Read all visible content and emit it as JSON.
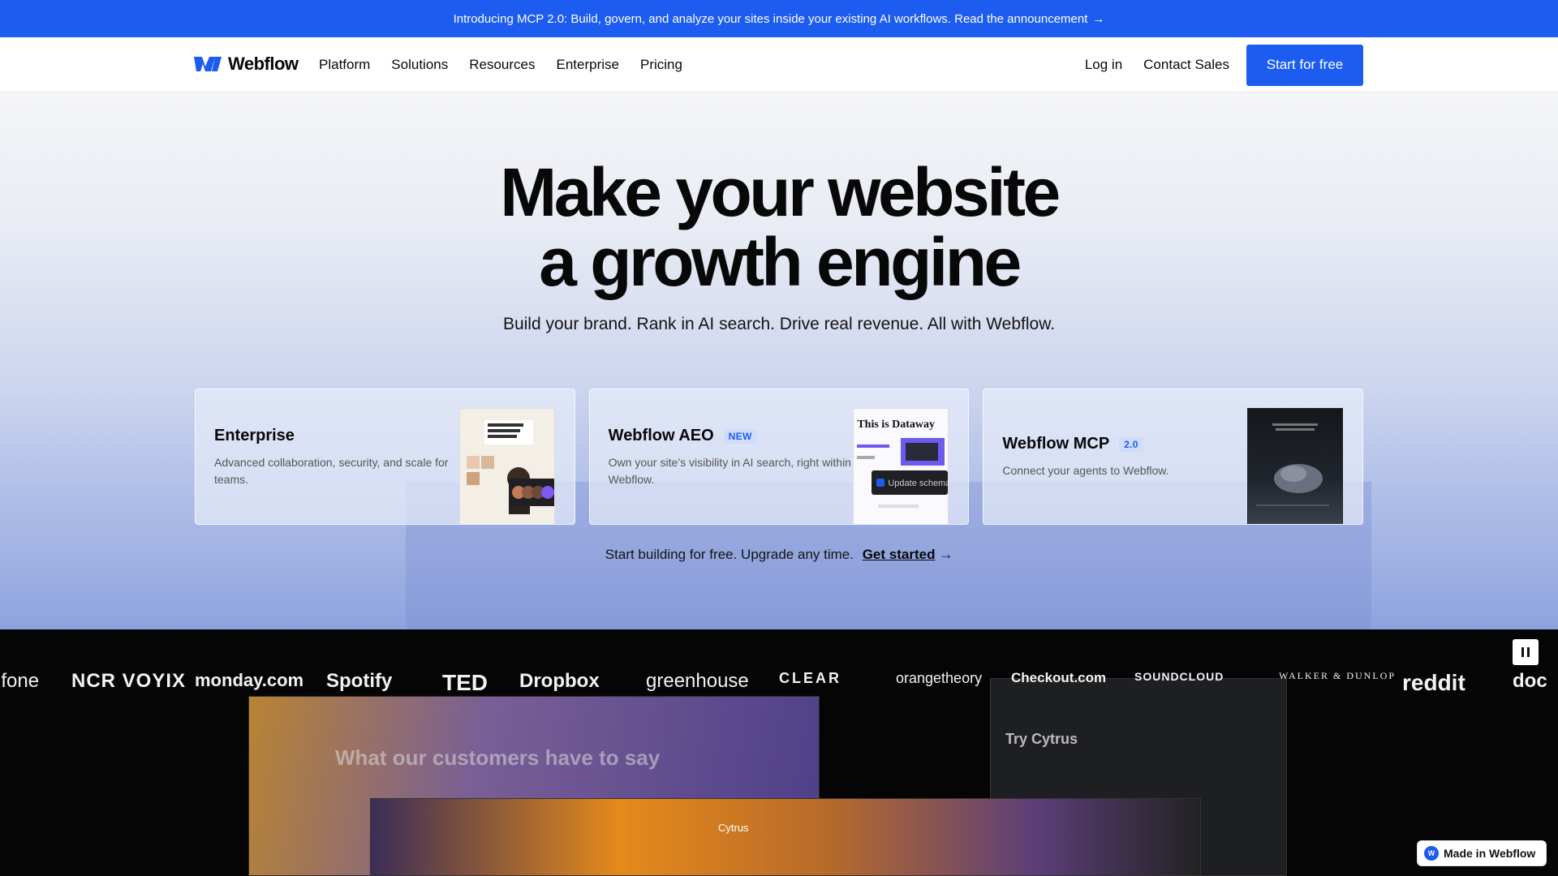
{
  "banner": {
    "text": "Introducing MCP 2.0: Build, govern, and analyze your sites inside your existing AI workflows. Read the announcement",
    "arrow": "→"
  },
  "nav": {
    "brand": "Webflow",
    "links": [
      "Platform",
      "Solutions",
      "Resources",
      "Enterprise",
      "Pricing"
    ],
    "login": "Log in",
    "contact": "Contact Sales",
    "cta": "Start for free"
  },
  "hero": {
    "title_line1": "Make your website",
    "title_line2": "a growth engine",
    "subtitle": "Build your brand. Rank in AI search. Drive real revenue. All with Webflow.",
    "cta_text": "Start building for free. Upgrade any time.",
    "cta_link": "Get started",
    "cta_arrow": "→"
  },
  "cards": [
    {
      "title": "Enterprise",
      "badge": "",
      "desc": "Advanced collaboration, security, and scale for teams."
    },
    {
      "title": "Webflow AEO",
      "badge": "NEW",
      "desc": "Own your site’s visibility in AI search, right within Webflow.",
      "thumb_headline": "This is Dataway",
      "thumb_chip": "Update schema"
    },
    {
      "title": "Webflow MCP",
      "badge": "2.0",
      "desc": "Connect your agents to Webflow."
    }
  ],
  "customers": [
    "ifone",
    "NCR VOYIX",
    "monday.com",
    "Spotify",
    "TED",
    "Dropbox",
    "greenhouse",
    "CLEAR",
    "orangetheory",
    "Checkout.com",
    "SOUNDCLOUD",
    "WALKER & DUNLOP",
    "reddit",
    "doc"
  ],
  "screens": {
    "s1": "What our customers have to say",
    "s2": "Cytrus",
    "s3": "Try Cytrus"
  },
  "made_in": "Made in Webflow",
  "colors": {
    "brand_blue": "#1d5cf0",
    "dark": "#080808"
  }
}
